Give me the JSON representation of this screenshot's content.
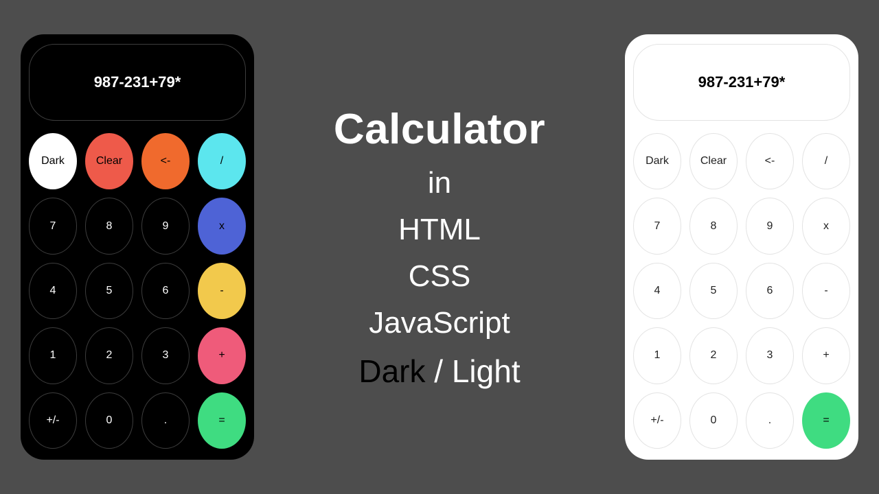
{
  "display_value": "987-231+79*",
  "keys": {
    "theme": "Dark",
    "clear": "Clear",
    "back": "<-",
    "div": "/",
    "d7": "7",
    "d8": "8",
    "d9": "9",
    "mul": "x",
    "d4": "4",
    "d5": "5",
    "d6": "6",
    "sub": "-",
    "d1": "1",
    "d2": "2",
    "d3": "3",
    "add": "+",
    "sign": "+/-",
    "d0": "0",
    "dot": ".",
    "eq": "="
  },
  "title": {
    "main": "Calculator",
    "line2": "in",
    "line3": "HTML",
    "line4": "CSS",
    "line5": "JavaScript",
    "mode_dark": "Dark",
    "mode_sep": " / ",
    "mode_light": "Light"
  }
}
